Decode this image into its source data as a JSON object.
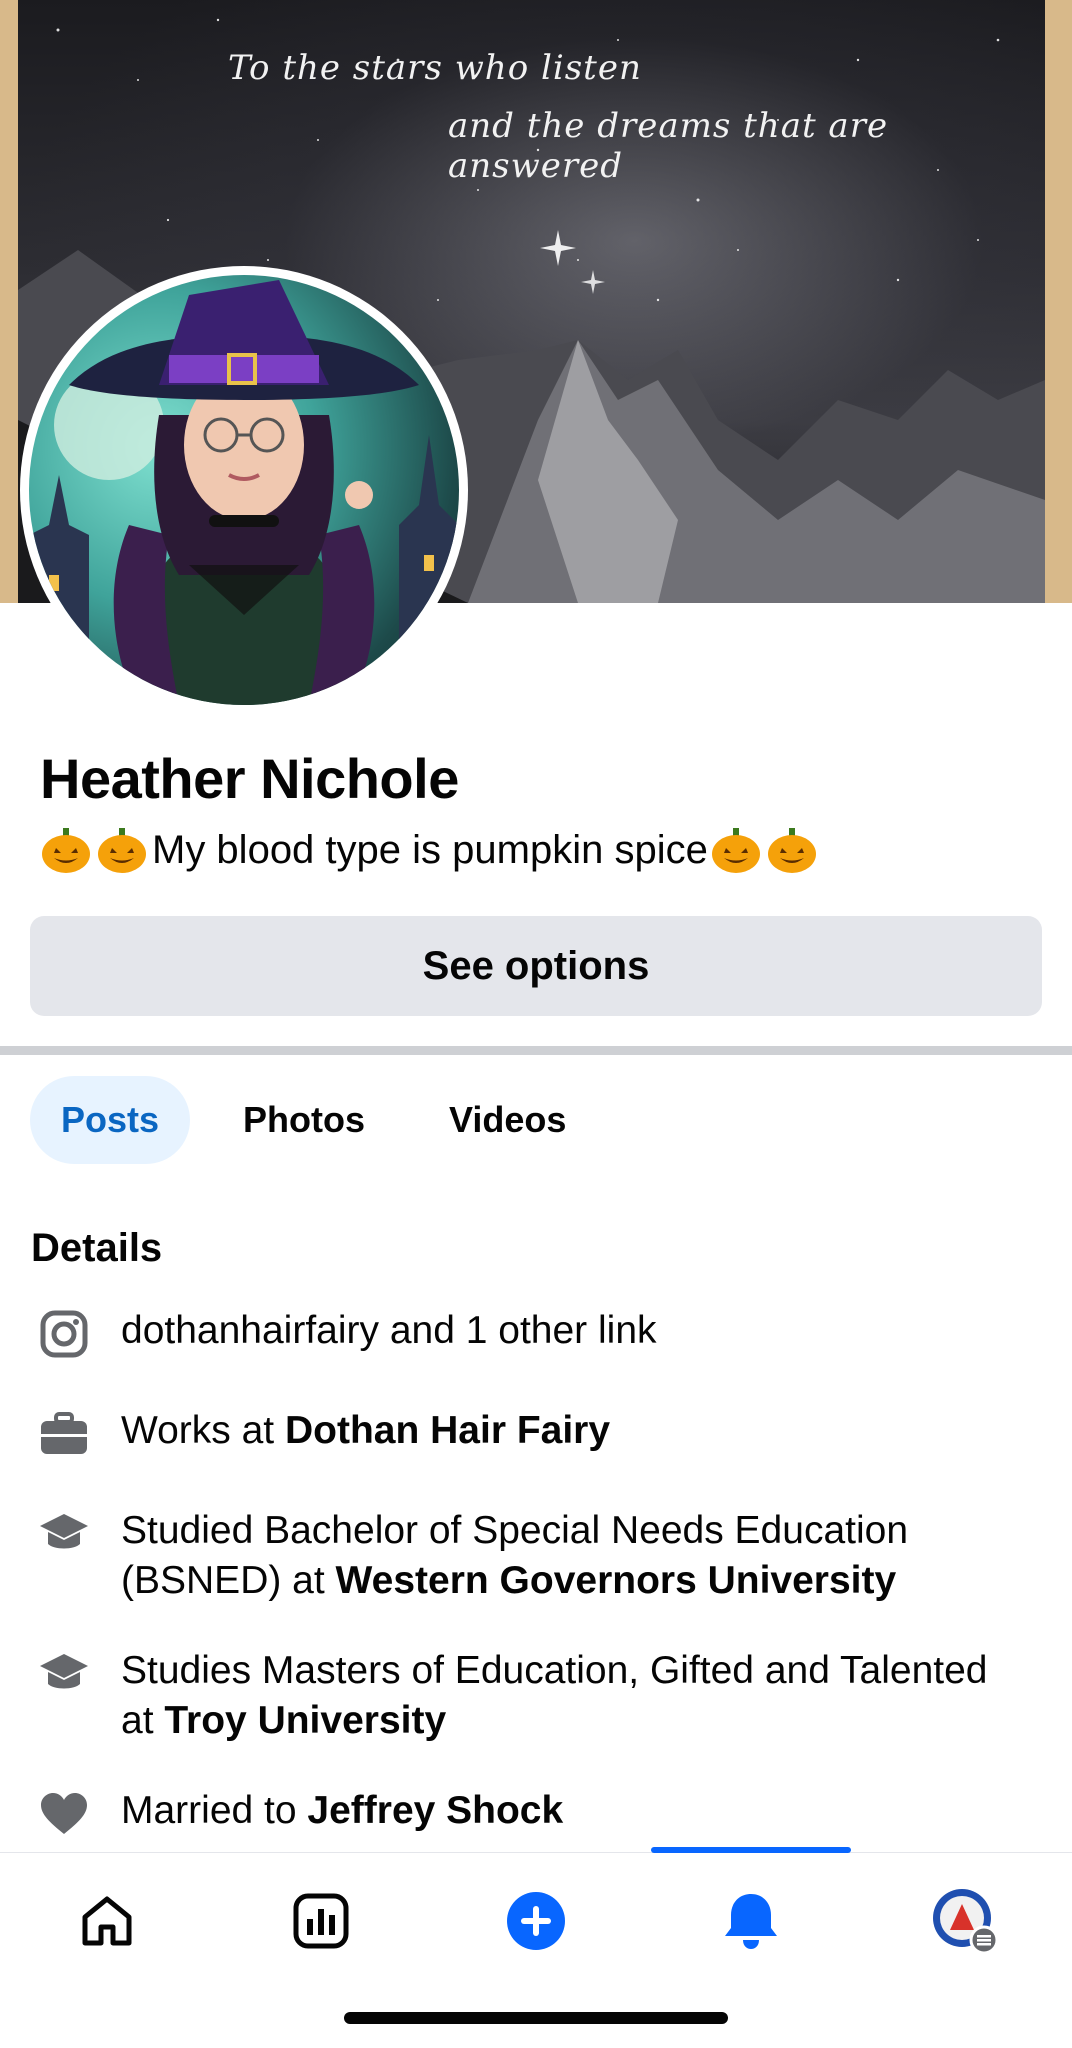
{
  "cover": {
    "quote_line1": "To the stars who listen",
    "quote_line2": "and the dreams that are answered"
  },
  "profile": {
    "name": "Heather Nichole",
    "bio_text": "My blood type is pumpkin spice",
    "bio_emoji": "🎃"
  },
  "actions": {
    "see_options_label": "See options"
  },
  "tabs": [
    {
      "label": "Posts",
      "active": true
    },
    {
      "label": "Photos",
      "active": false
    },
    {
      "label": "Videos",
      "active": false
    }
  ],
  "details": {
    "title": "Details",
    "items": [
      {
        "icon": "instagram-icon",
        "prefix": "dothanhairfairy and 1 other link",
        "bold": ""
      },
      {
        "icon": "briefcase-icon",
        "prefix": "Works at ",
        "bold": "Dothan Hair Fairy"
      },
      {
        "icon": "graduation-cap-icon",
        "prefix": "Studied Bachelor of Special Needs Education (BSNED) at ",
        "bold": "Western Governors University"
      },
      {
        "icon": "graduation-cap-icon",
        "prefix": "Studies Masters of Education, Gifted and Talented at ",
        "bold": "Troy University"
      },
      {
        "icon": "heart-icon",
        "prefix": "Married to ",
        "bold": "Jeffrey Shock"
      }
    ]
  },
  "bottom_nav": {
    "items": [
      "home-icon",
      "dashboard-icon",
      "create-icon",
      "notifications-icon",
      "profile-menu-icon"
    ],
    "active": "notifications-icon"
  },
  "colors": {
    "accent": "#0866ff",
    "tab_active_bg": "#e7f3ff",
    "tab_active_text": "#0a66c2",
    "button_bg": "#e4e6eb",
    "divider": "#ced0d4"
  }
}
